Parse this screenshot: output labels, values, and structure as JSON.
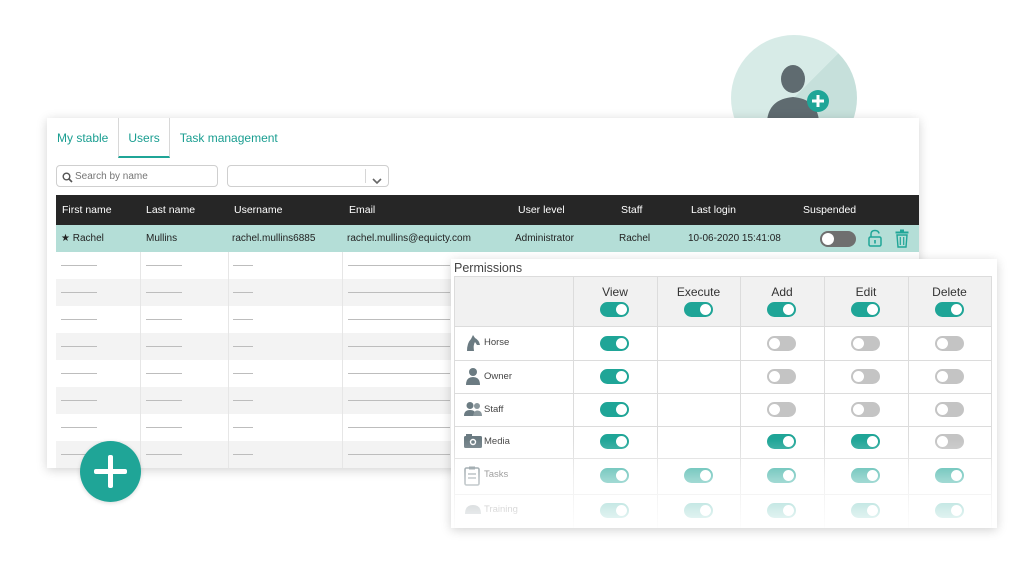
{
  "tabs": [
    {
      "label": "My stable"
    },
    {
      "label": "Users"
    },
    {
      "label": "Task management"
    }
  ],
  "search": {
    "placeholder": "Search by name"
  },
  "filter": {
    "value": ""
  },
  "users_table": {
    "headers": [
      "First name",
      "Last name",
      "Username",
      "Email",
      "User level",
      "Staff",
      "Last login",
      "Suspended"
    ],
    "selected_row": {
      "first_name": "★ Rachel",
      "last_name": "Mullins",
      "username": "rachel.mullins6885",
      "email": "rachel.mullins@equicty.com",
      "user_level": "Administrator",
      "staff": "Rachel",
      "last_login": "10-06-2020 15:41:08",
      "suspended": false
    },
    "placeholder_rows": 8
  },
  "permissions": {
    "title": "Permissions",
    "columns": [
      "View",
      "Execute",
      "Add",
      "Edit",
      "Delete"
    ],
    "header_toggles": [
      true,
      true,
      true,
      true,
      true
    ],
    "rows": [
      {
        "label": "Horse",
        "icon": "horse-icon",
        "toggles": [
          true,
          null,
          false,
          false,
          false
        ]
      },
      {
        "label": "Owner",
        "icon": "owner-icon",
        "toggles": [
          true,
          null,
          false,
          false,
          false
        ]
      },
      {
        "label": "Staff",
        "icon": "staff-icon",
        "toggles": [
          true,
          null,
          false,
          false,
          false
        ]
      },
      {
        "label": "Media",
        "icon": "media-icon",
        "toggles": [
          true,
          null,
          true,
          true,
          false
        ]
      },
      {
        "label": "Tasks",
        "icon": "tasks-icon",
        "toggles": [
          true,
          true,
          true,
          true,
          true
        ]
      },
      {
        "label": "Training",
        "icon": "training-icon",
        "toggles": [
          true,
          true,
          true,
          true,
          true
        ]
      }
    ]
  },
  "colors": {
    "accent": "#1fa597",
    "header_bg": "#262626",
    "selected_row": "#b4ded7",
    "toggle_off": "#c4c4c4"
  }
}
